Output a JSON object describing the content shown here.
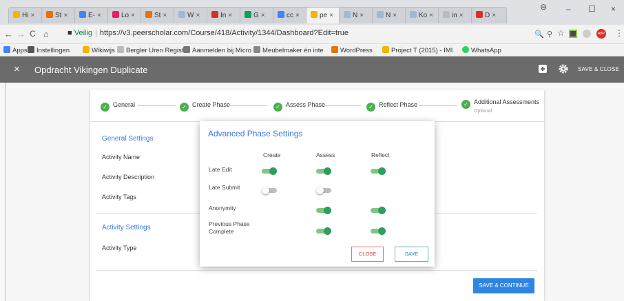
{
  "browser": {
    "tabs": [
      {
        "label": "Hi",
        "color": "#f4b400"
      },
      {
        "label": "St",
        "color": "#e8710a"
      },
      {
        "label": "E-",
        "color": "#4285f4"
      },
      {
        "label": "Lo",
        "color": "#e91e63"
      },
      {
        "label": "St",
        "color": "#e8710a"
      },
      {
        "label": "W",
        "color": "#9fb8d4"
      },
      {
        "label": "In",
        "color": "#d93025"
      },
      {
        "label": "G",
        "color": "#0f9d58"
      },
      {
        "label": "cc",
        "color": "#4285f4"
      },
      {
        "label": "pe",
        "color": "#f4b400"
      },
      {
        "label": "N",
        "color": "#9fb8d4"
      },
      {
        "label": "N",
        "color": "#9fb8d4"
      },
      {
        "label": "Ko",
        "color": "#9fb8d4"
      },
      {
        "label": "in",
        "color": "#bbbbbb"
      },
      {
        "label": "D",
        "color": "#d93025"
      }
    ],
    "tab_close": "×",
    "window_controls": {
      "minimize": "–",
      "maximize": "☐",
      "close": "×",
      "profile": "⊖"
    },
    "nav": {
      "back": "←",
      "forward": "→",
      "reload": "C",
      "home": "⌂"
    },
    "url": {
      "secure_label": "Veilig",
      "address": "https://v3.peerscholar.com/Course/418/Activity/1344/Dashboard?Edit=true"
    },
    "toolbar_icons": [
      "zoom-icon",
      "pin-icon",
      "star-icon",
      "extension-icon",
      "extension-icon",
      "adblock-icon",
      "menu-icon"
    ],
    "toolbar_glyphs": {
      "zoom": "🔍",
      "pin": "⚲",
      "star": "☆",
      "menu": "⋮",
      "adblock": "ABP"
    },
    "bookmarks": [
      {
        "label": "Apps",
        "color": "#4285f4"
      },
      {
        "label": "Instellingen",
        "color": "#555555"
      },
      {
        "label": "Wikiwijs",
        "color": "#f4b400"
      },
      {
        "label": "Bergler Uren Registra",
        "color": "#bbbbbb"
      },
      {
        "label": "Aanmelden bij Micro",
        "color": "#777777"
      },
      {
        "label": "Meubelmaker én inte",
        "color": "#888888"
      },
      {
        "label": "WordPress",
        "color": "#e8710a"
      },
      {
        "label": "Project T (2015) - IMI",
        "color": "#f4b400"
      },
      {
        "label": "WhatsApp",
        "color": "#25d366"
      }
    ]
  },
  "header": {
    "close_glyph": "×",
    "title": "Opdracht Vikingen Duplicate",
    "save_close_label": "SAVE & CLOSE"
  },
  "stepper": {
    "check_glyph": "✓",
    "steps": [
      "General",
      "Create Phase",
      "Assess Phase",
      "Reflect Phase",
      "Additional Assessments"
    ],
    "optional_label": "Optional"
  },
  "general_settings": {
    "title": "General Settings",
    "fields": [
      "Activity Name",
      "Activity Description",
      "Activity Tags"
    ]
  },
  "activity_settings": {
    "title": "Activity Settings",
    "fields": [
      "Activity Type"
    ]
  },
  "save_continue_label": "SAVE & CONTINUE",
  "modal": {
    "title": "Advanced Phase Settings",
    "columns": [
      "Create",
      "Assess",
      "Reflect"
    ],
    "rows": [
      {
        "label": "Late Edit",
        "create": true,
        "assess": true,
        "reflect": true
      },
      {
        "label": "Late Submit",
        "create": false,
        "assess": false,
        "reflect": null
      },
      {
        "label": "Anonymity",
        "create": null,
        "assess": true,
        "reflect": true
      },
      {
        "label": "Previous Phase Complete",
        "create": null,
        "assess": true,
        "reflect": true
      }
    ],
    "close_label": "CLOSE",
    "save_label": "SAVE"
  },
  "colors": {
    "accent": "#3a7bd5",
    "primary_button": "#2f86e0",
    "toggle_on": "#2e9e5b",
    "step_check": "#4caf50",
    "header_bg": "#6b6b6b",
    "close_red": "#e53935"
  }
}
